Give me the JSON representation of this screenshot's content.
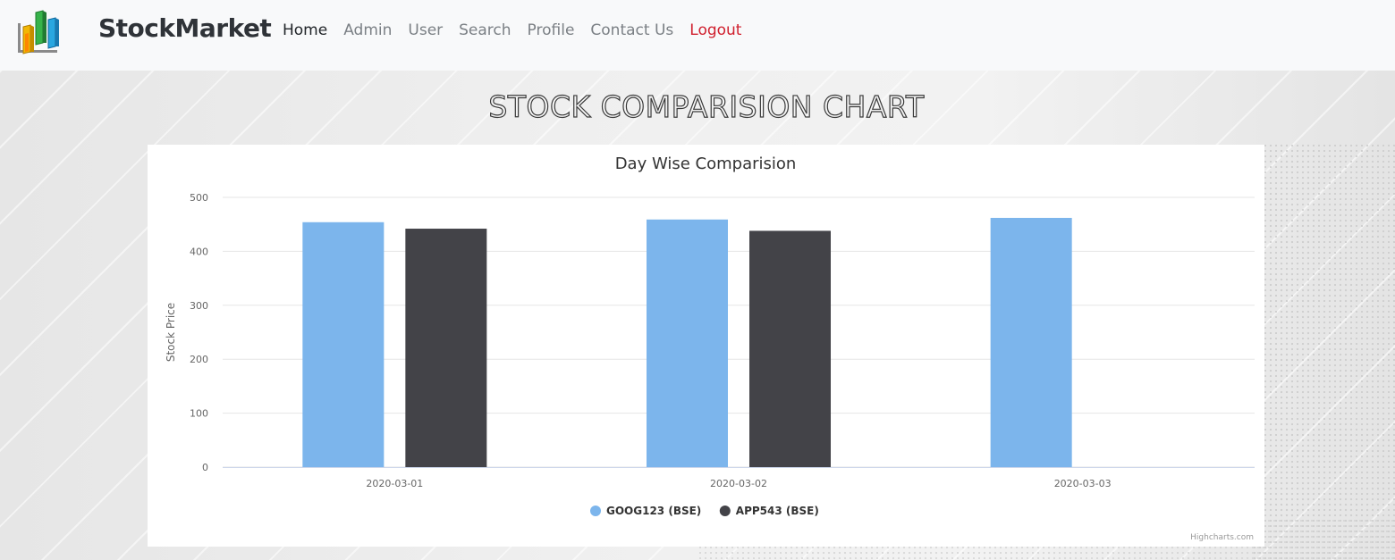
{
  "app": {
    "brand": "StockMarket",
    "nav": [
      {
        "label": "Home",
        "active": true
      },
      {
        "label": "Admin"
      },
      {
        "label": "User"
      },
      {
        "label": "Search"
      },
      {
        "label": "Profile"
      },
      {
        "label": "Contact Us"
      },
      {
        "label": "Logout",
        "color": "#d0202e"
      }
    ]
  },
  "page": {
    "title": "STOCK COMPARISION CHART"
  },
  "chart_data": {
    "type": "bar",
    "title": "Day Wise Comparision",
    "ylabel": "Stock Price",
    "xlabel": "",
    "ylim": [
      0,
      500
    ],
    "yticks": [
      0,
      100,
      200,
      300,
      400,
      500
    ],
    "categories": [
      "2020-03-01",
      "2020-03-02",
      "2020-03-03"
    ],
    "series": [
      {
        "name": "GOOG123 (BSE)",
        "color": "#7cb5ec",
        "values": [
          454,
          459,
          462
        ]
      },
      {
        "name": "APP543 (BSE)",
        "color": "#434348",
        "values": [
          442,
          438,
          null
        ]
      }
    ],
    "grid": true,
    "legend_position": "bottom-center",
    "credits": "Highcharts.com"
  }
}
